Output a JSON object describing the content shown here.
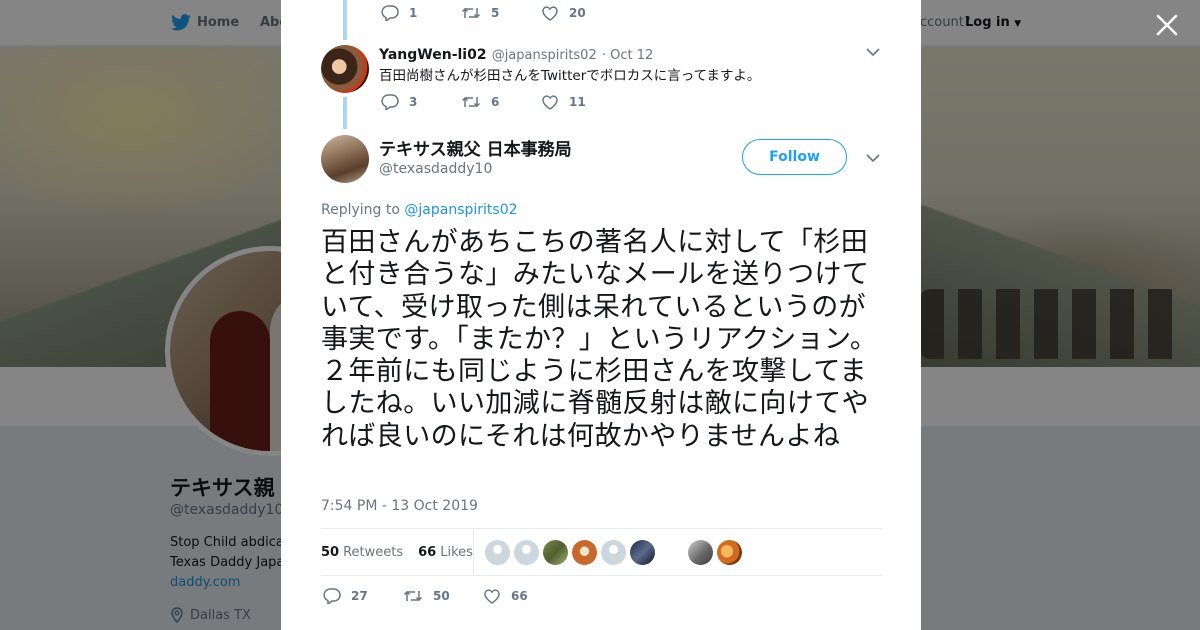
{
  "topbar": {
    "home_label": "Home",
    "about_label": "Abo",
    "account_text": "ccount?",
    "login_label": "Log in"
  },
  "profile": {
    "display_name": "テキサス親",
    "handle": "@texasdaddy10",
    "bio_line1": "Stop Child abdica",
    "bio_line2": "Texas Daddy Japa",
    "link": "daddy.com",
    "location": "Dallas TX"
  },
  "prev_tweet": {
    "replies": "1",
    "retweets": "5",
    "likes": "20"
  },
  "reply_tweet": {
    "name": "YangWen-li02",
    "handle": "@japanspirits02",
    "date": "· Oct 12",
    "text": "百田尚樹さんが杉田さんをTwitterでボロカスに言ってますよ。",
    "replies": "3",
    "retweets": "6",
    "likes": "11"
  },
  "main_tweet": {
    "name": "テキサス親父 日本事務局",
    "handle": "@texasdaddy10",
    "follow_label": "Follow",
    "replying_prefix": "Replying to",
    "replying_handle": "@japanspirits02",
    "text": "百田さんがあちこちの著名人に対して「杉田と付き合うな」みたいなメールを送りつけていて、受け取った側は呆れているというのが事実です。「またか？」というリアクション。２年前にも同じように杉田さんを攻撃してましたね。いい加減に脊髄反射は敵に向けてやれば良いのにそれは何故かやりませんよね",
    "timestamp": "7:54 PM - 13 Oct 2019",
    "retweets_count": "50",
    "retweets_label": "Retweets",
    "likes_count": "66",
    "likes_label": "Likes",
    "replies": "27",
    "retweets": "50",
    "likes": "66"
  },
  "colors": {
    "accent": "#1da1f2",
    "thread_line": "#a9d6f6",
    "muted": "#657786",
    "text": "#14171a"
  }
}
